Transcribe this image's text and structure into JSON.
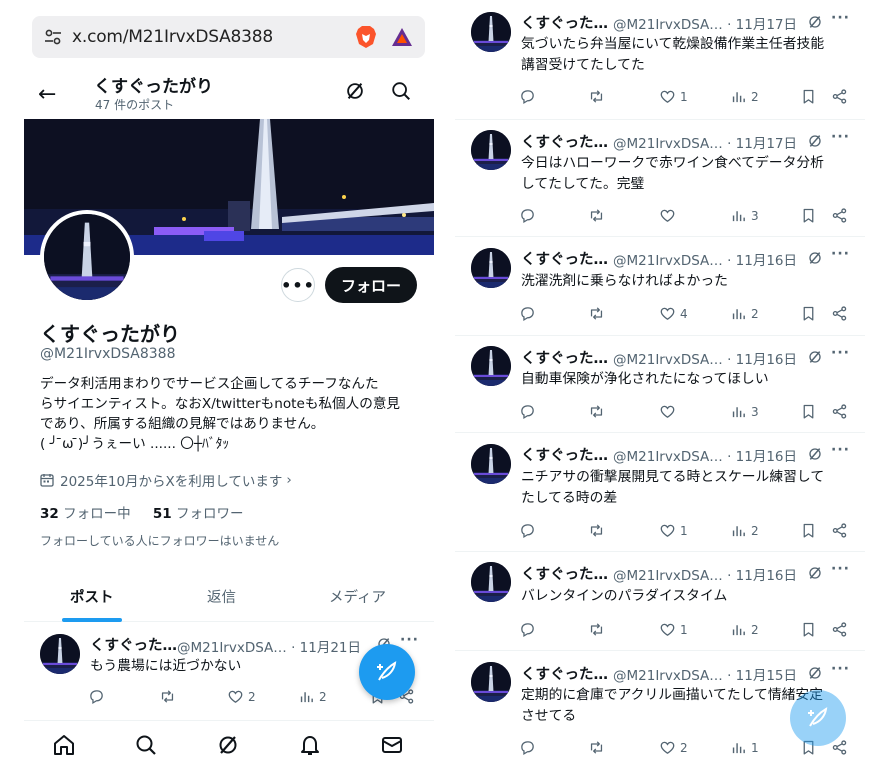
{
  "browser": {
    "url": "x.com/M21IrvxDSA8388"
  },
  "profile": {
    "header_name": "くすぐったがり",
    "post_count": "47 件のポスト",
    "display_name": "くすぐったがり",
    "handle": "@M21IrvxDSA8388",
    "bio_lines": [
      "データ利活用まわりでサービス企画してるチーフなんた",
      "らサイエンティスト。なおX/twitterもnoteも私個人の意見",
      "であり、所属する組織の見解ではありません。",
      "( ╯ ̄ω ̄)╯うぇーい ...... 〇┼ﾊﾞﾀｯ"
    ],
    "joined": "2025年10月からXを利用しています",
    "following_count": "32",
    "following_label": "フォロー中",
    "followers_count": "51",
    "followers_label": "フォロワー",
    "no_mutual": "フォローしている人にフォロワーはいません",
    "more_label": "•••",
    "follow_label": "フォロー"
  },
  "tabs": [
    "ポスト",
    "返信",
    "メディア"
  ],
  "left_post": {
    "name": "くすぐった…",
    "meta": "@M21IrvxDSA… · 11月21日",
    "text": "もう農場には近づかない",
    "likes": "2",
    "views": "2"
  },
  "bottom_nav": [
    "home-icon",
    "search-icon",
    "grok-icon",
    "notifications-icon",
    "messages-icon"
  ],
  "feed": [
    {
      "name": "くすぐった…",
      "meta": "@M21IrvxDSA… · 11月17日",
      "lines": [
        "気づいたら弁当屋にいて乾燥設備作業主任者技能",
        "講習受けてたしてた"
      ],
      "likes": "1",
      "views": "2"
    },
    {
      "name": "くすぐった…",
      "meta": "@M21IrvxDSA… · 11月17日",
      "lines": [
        "今日はハローワークで赤ワイン食べてデータ分析",
        "してたしてた。完璧"
      ],
      "likes": "",
      "views": "3"
    },
    {
      "name": "くすぐった…",
      "meta": "@M21IrvxDSA… · 11月16日",
      "lines": [
        "洗濯洗剤に乗らなければよかった"
      ],
      "likes": "4",
      "views": "2"
    },
    {
      "name": "くすぐった…",
      "meta": "@M21IrvxDSA… · 11月16日",
      "lines": [
        "自動車保険が浄化されたになってほしい"
      ],
      "likes": "",
      "views": "3"
    },
    {
      "name": "くすぐった…",
      "meta": "@M21IrvxDSA… · 11月16日",
      "lines": [
        "ニチアサの衝撃展開見てる時とスケール練習して",
        "たしてる時の差"
      ],
      "likes": "1",
      "views": "2"
    },
    {
      "name": "くすぐった…",
      "meta": "@M21IrvxDSA… · 11月16日",
      "lines": [
        "バレンタインのパラダイスタイム"
      ],
      "likes": "1",
      "views": "2"
    },
    {
      "name": "くすぐった…",
      "meta": "@M21IrvxDSA… · 11月15日",
      "lines": [
        "定期的に倉庫でアクリル画描いてたして情緒安定",
        "させてる"
      ],
      "likes": "2",
      "views": "1"
    }
  ],
  "colors": {
    "accent": "#1d9bf0",
    "text": "#0f1419",
    "muted": "#536471",
    "border": "#eff3f4",
    "brave": "#fb542b"
  }
}
